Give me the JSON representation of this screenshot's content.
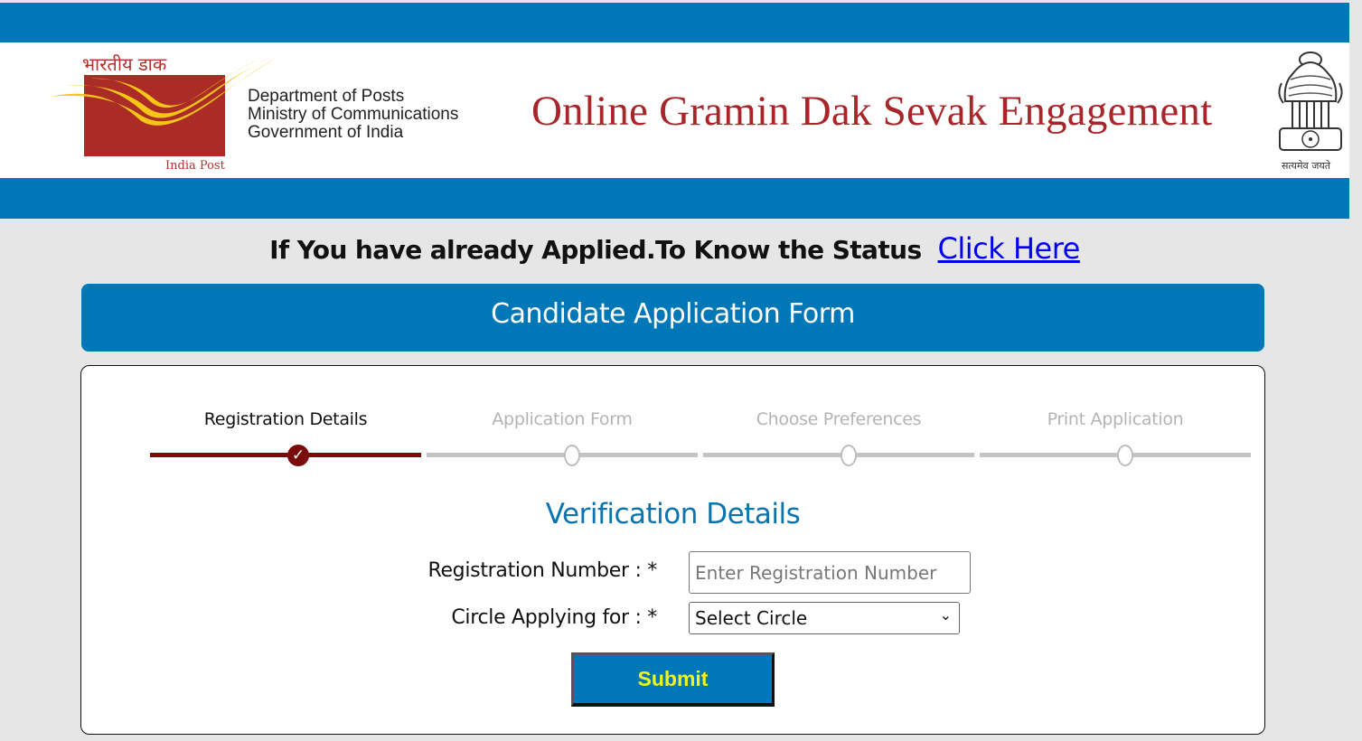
{
  "header": {
    "logo_hindi": "भारतीय डाक",
    "logo_english": "India Post",
    "department_lines": [
      "Department of Posts",
      "Ministry of Communications",
      "Government of India"
    ],
    "site_title": "Online Gramin Dak Sevak Engagement",
    "emblem_motto": "सत्यमेव जयते"
  },
  "status_notice": {
    "text": "If You have already Applied.To Know the Status",
    "link_label": "Click Here"
  },
  "form_header": {
    "title": "Candidate Application Form"
  },
  "stepper": {
    "steps": [
      {
        "label": "Registration Details",
        "state": "completed",
        "icon": "check-icon"
      },
      {
        "label": "Application Form",
        "state": "pending",
        "icon": "circle-icon"
      },
      {
        "label": "Choose Preferences",
        "state": "pending",
        "icon": "circle-icon"
      },
      {
        "label": "Print Application",
        "state": "pending",
        "icon": "circle-icon"
      }
    ],
    "check_glyph": "✓"
  },
  "verification": {
    "title": "Verification Details",
    "registration_label": "Registration Number : *",
    "registration_value": "",
    "registration_placeholder": "Enter Registration Number",
    "circle_label": "Circle Applying for : *",
    "circle_selected": "Select Circle",
    "chevron_glyph": "⌄",
    "submit_label": "Submit"
  },
  "colors": {
    "brand_blue": "#0077b6",
    "title_red": "#a8262a",
    "step_active": "#7a0c0c",
    "step_pending": "#c4c4c4",
    "submit_text": "#f5f516",
    "link_blue": "#0000ee"
  }
}
